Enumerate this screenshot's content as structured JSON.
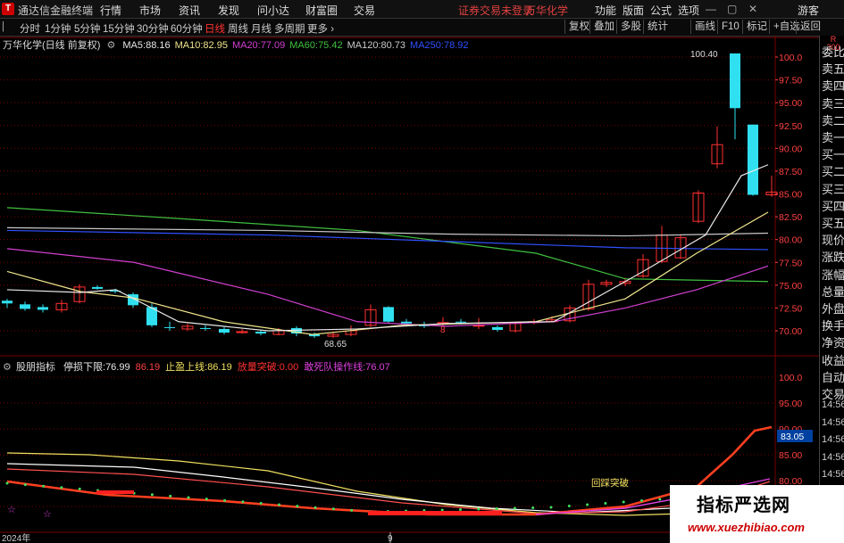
{
  "app": {
    "title": "通达信金融终端",
    "logo": "T"
  },
  "menu": [
    "行情",
    "市场",
    "资讯",
    "发现",
    "问小达",
    "财富圈",
    "交易"
  ],
  "menu_notice": "证券交易未登录",
  "stock_name_top": "万华化学",
  "menu_right": [
    "功能",
    "版面",
    "公式",
    "选项"
  ],
  "user": "游客",
  "toolbar": {
    "periods": [
      "分时",
      "1分钟",
      "5分钟",
      "15分钟",
      "30分钟",
      "60分钟",
      "日线",
      "周线",
      "月线",
      "多周期",
      "更多 ›"
    ],
    "active_index": 6,
    "right": [
      "复权",
      "叠加",
      "多股",
      "统计",
      "画线",
      "F10",
      "标记",
      "+自选",
      "返回"
    ]
  },
  "main_chart": {
    "title": "万华化学(日线 前复权)",
    "ma": [
      {
        "label": "MA5:",
        "value": "88.16",
        "color": "#e8e8e8"
      },
      {
        "label": "MA10:",
        "value": "82.95",
        "color": "#f0e68c"
      },
      {
        "label": "MA20:",
        "value": "77.09",
        "color": "#d040d0"
      },
      {
        "label": "MA60:",
        "value": "75.42",
        "color": "#40c040"
      },
      {
        "label": "MA120:",
        "value": "80.73",
        "color": "#c8c8c8"
      },
      {
        "label": "MA250:",
        "value": "78.92",
        "color": "#3050ff"
      }
    ],
    "y_ticks": [
      "100.0",
      "97.50",
      "95.00",
      "92.50",
      "90.00",
      "87.50",
      "85.00",
      "82.50",
      "80.00",
      "77.50",
      "75.00",
      "72.50",
      "70.00"
    ],
    "high_label": "100.40",
    "low_label": "68.65",
    "marker": "8"
  },
  "indicator": {
    "title": "股朋指标",
    "fields": [
      {
        "label": "停损下限:",
        "value": "76.99",
        "color": "#e8e8e8"
      },
      {
        "label": "",
        "value": "86.19",
        "color": "#ff4040"
      },
      {
        "label": "止盈上线:",
        "value": "86.19",
        "color": "#f0e060"
      },
      {
        "label": "放量突破:",
        "value": "0.00",
        "color": "#ff3030"
      },
      {
        "label": "敢死队操作线:",
        "value": "76.07",
        "color": "#e040e0"
      }
    ],
    "y_ticks": [
      "100.0",
      "95.00",
      "90.00",
      "85.00",
      "80.00",
      "75.00"
    ],
    "current_value": "83.05",
    "annotation": "回踩突破"
  },
  "x_axis": {
    "year_label": "2024年",
    "month_label": "9"
  },
  "right_panel": [
    "委比",
    "卖五",
    "卖四",
    "卖三",
    "卖二",
    "卖一",
    "买一",
    "买二",
    "买三",
    "买四",
    "买五",
    "现价",
    "涨跌",
    "涨幅",
    "总量",
    "外盘",
    "换手",
    "净资",
    "收益",
    "自动",
    "交易"
  ],
  "right_panel_times": [
    "14:56",
    "14:56",
    "14:56",
    "14:56",
    "14:56",
    "14:56",
    "14:56",
    "14:56"
  ],
  "right_panel_top": "R 300",
  "watermark": {
    "title": "指标严选网",
    "url": "www.xuezhibiao.com"
  },
  "colors": {
    "up": "#ff3030",
    "down": "#30e0f0",
    "grid": "#7a0000",
    "axis_text": "#ff4040"
  }
}
